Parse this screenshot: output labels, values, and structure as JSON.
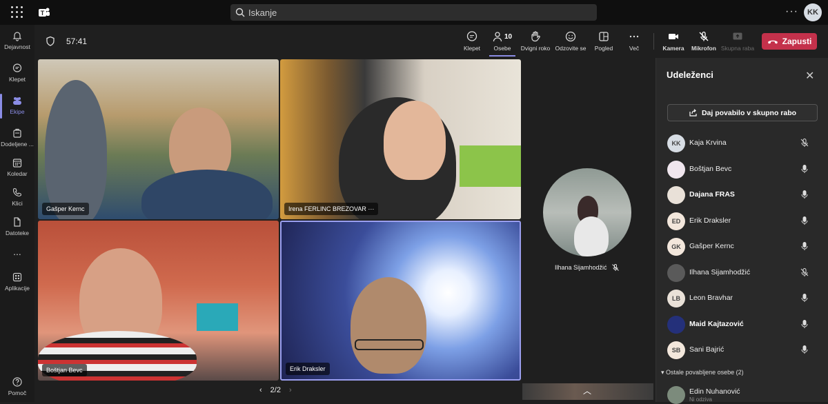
{
  "search": {
    "placeholder": "Iskanje"
  },
  "user": {
    "initials": "KK"
  },
  "rail": {
    "items": [
      {
        "label": "Dejavnost",
        "icon": "bell-icon"
      },
      {
        "label": "Klepet",
        "icon": "chat-icon"
      },
      {
        "label": "Ekipe",
        "icon": "teams-icon"
      },
      {
        "label": "Dodeljene ...",
        "icon": "assignments-icon"
      },
      {
        "label": "Koledar",
        "icon": "calendar-icon"
      },
      {
        "label": "Klici",
        "icon": "phone-icon"
      },
      {
        "label": "Datoteke",
        "icon": "file-icon"
      },
      {
        "label": "...",
        "icon": "more-icon"
      },
      {
        "label": "Aplikacije",
        "icon": "apps-icon"
      },
      {
        "label": "Pomoč",
        "icon": "help-icon"
      }
    ]
  },
  "meeting": {
    "timer": "57:41",
    "controls": {
      "chat": "Klepet",
      "people": "Osebe",
      "people_count": "10",
      "raise": "Dvigni roko",
      "react": "Odzovite se",
      "view": "Pogled",
      "more": "Več",
      "camera": "Kamera",
      "mic": "Mikrofon",
      "share": "Skupna raba"
    },
    "leave": "Zapusti",
    "accent_color": "#8b8de6",
    "leave_color": "#c4314b"
  },
  "tiles": [
    {
      "name": "Gašper Kernc"
    },
    {
      "name": "Irena FERLINC BREZOVAR",
      "more": "···"
    },
    {
      "name": "Boštjan Bevc"
    },
    {
      "name": "Erik Draksler"
    }
  ],
  "side_participant": {
    "name": "Ilhana Sijamhodžić"
  },
  "pager": {
    "text": "2/2"
  },
  "panel": {
    "title": "Udeleženci",
    "share_label": "Daj povabilo v skupno rabo",
    "participants": [
      {
        "initials": "KK",
        "name": "Kaja Krvina",
        "bold": false,
        "muted": true
      },
      {
        "initials": "",
        "name": "Boštjan Bevc",
        "bold": false,
        "muted": false
      },
      {
        "initials": "",
        "name": "Dajana FRAS",
        "bold": true,
        "muted": false
      },
      {
        "initials": "ED",
        "name": "Erik Draksler",
        "bold": false,
        "muted": false
      },
      {
        "initials": "GK",
        "name": "Gašper Kernc",
        "bold": false,
        "muted": false
      },
      {
        "initials": "",
        "name": "Ilhana Sijamhodžić",
        "bold": false,
        "muted": true
      },
      {
        "initials": "LB",
        "name": "Leon Bravhar",
        "bold": false,
        "muted": false
      },
      {
        "initials": "",
        "name": "Maid Kajtazović",
        "bold": true,
        "muted": false
      },
      {
        "initials": "SB",
        "name": "Sani Bajrić",
        "bold": false,
        "muted": false
      }
    ],
    "others_label": "Ostale povabljene osebe (2)",
    "last": {
      "name": "Edin Nuhanović",
      "sub": "Ni odziva"
    }
  }
}
